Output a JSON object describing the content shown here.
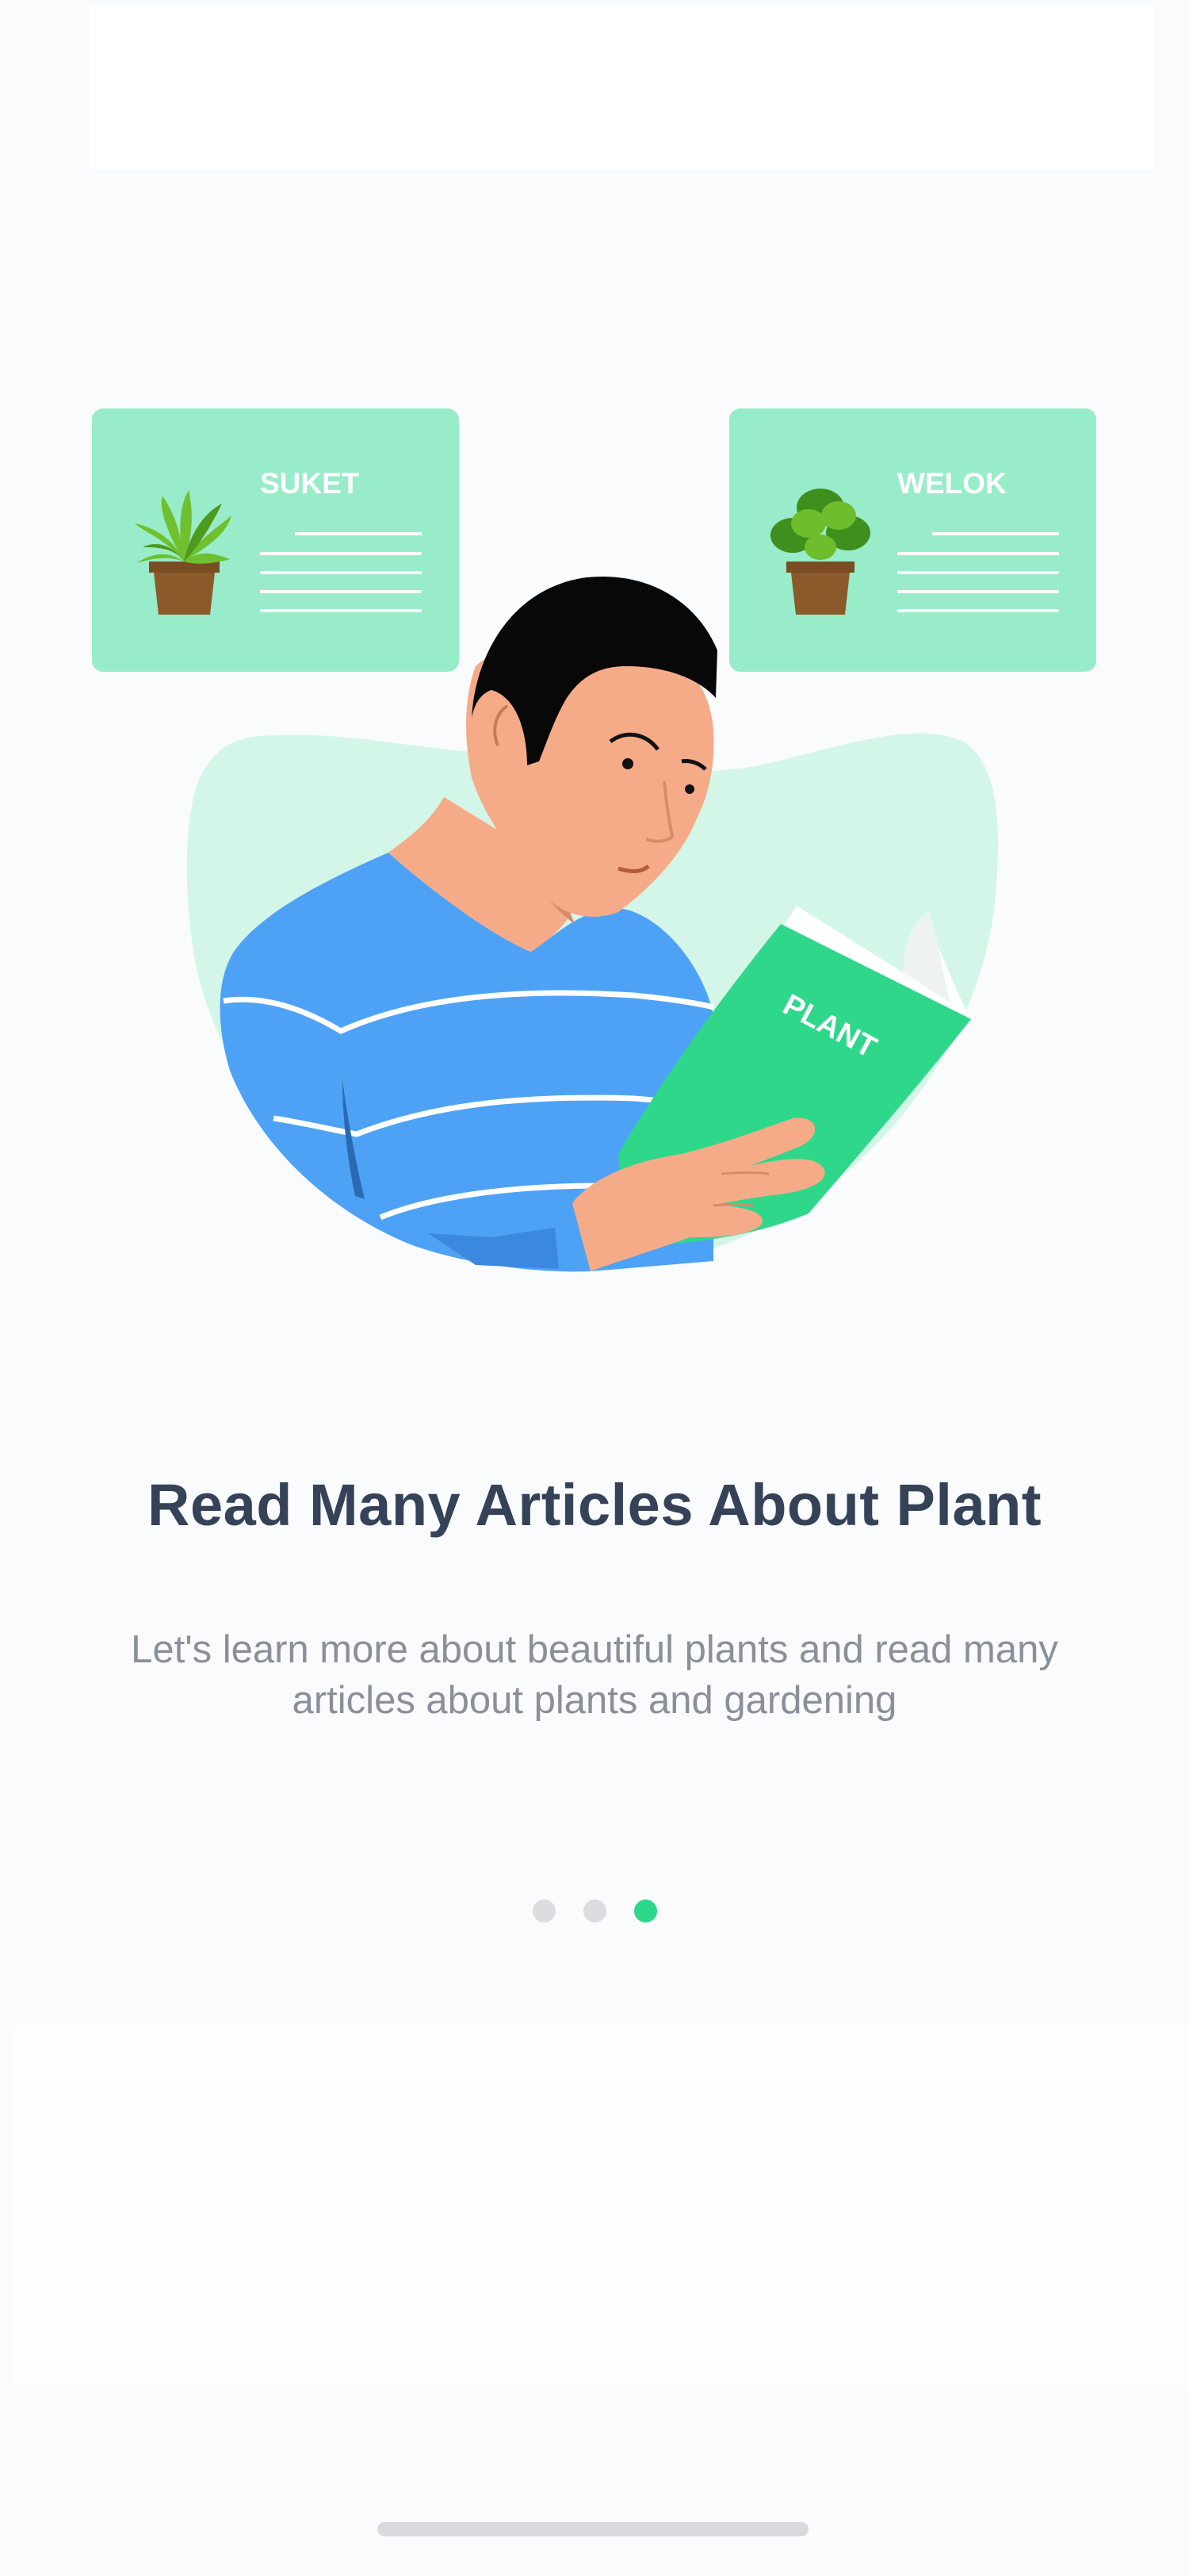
{
  "illustration": {
    "card_left_title": "SUKET",
    "card_right_title": "WELOK",
    "book_label": "PLANT"
  },
  "onboarding": {
    "title": "Read Many Articles About Plant",
    "subtitle": "Let's learn more about beautiful plants and read many articles about plants and gardening"
  },
  "pagination": {
    "total": 3,
    "active_index": 2
  },
  "colors": {
    "accent": "#2fd78b",
    "card": "#98ecc9",
    "title": "#354258",
    "subtitle": "#8a8f99",
    "shirt": "#4ea2f5"
  }
}
